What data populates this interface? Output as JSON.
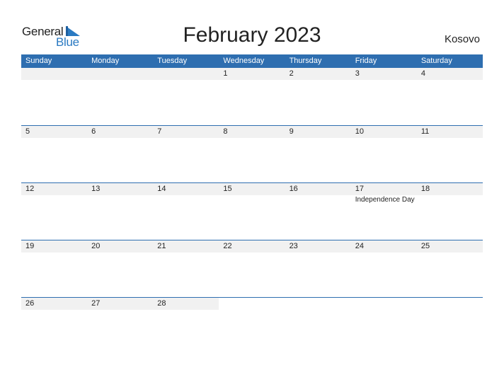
{
  "logo": {
    "word1": "General",
    "word2": "Blue",
    "accent_color": "#2a7ac2"
  },
  "title": "February 2023",
  "country": "Kosovo",
  "colors": {
    "header_bg": "#2e6eb0",
    "date_strip_bg": "#f1f1f1"
  },
  "weekdays": [
    "Sunday",
    "Monday",
    "Tuesday",
    "Wednesday",
    "Thursday",
    "Friday",
    "Saturday"
  ],
  "weeks": [
    {
      "days": [
        "",
        "",
        "",
        "1",
        "2",
        "3",
        "4"
      ],
      "events": [
        "",
        "",
        "",
        "",
        "",
        "",
        ""
      ]
    },
    {
      "days": [
        "5",
        "6",
        "7",
        "8",
        "9",
        "10",
        "11"
      ],
      "events": [
        "",
        "",
        "",
        "",
        "",
        "",
        ""
      ]
    },
    {
      "days": [
        "12",
        "13",
        "14",
        "15",
        "16",
        "17",
        "18"
      ],
      "events": [
        "",
        "",
        "",
        "",
        "",
        "Independence Day",
        ""
      ]
    },
    {
      "days": [
        "19",
        "20",
        "21",
        "22",
        "23",
        "24",
        "25"
      ],
      "events": [
        "",
        "",
        "",
        "",
        "",
        "",
        ""
      ]
    },
    {
      "days": [
        "26",
        "27",
        "28",
        "",
        "",
        "",
        ""
      ],
      "events": [
        "",
        "",
        "",
        "",
        "",
        "",
        ""
      ]
    }
  ]
}
